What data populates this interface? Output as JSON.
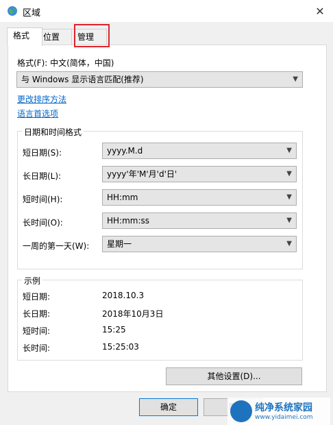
{
  "window": {
    "title": "区域",
    "close_glyph": "✕"
  },
  "tabs": [
    {
      "label": "格式"
    },
    {
      "label": "位置"
    },
    {
      "label": "管理"
    }
  ],
  "format": {
    "label": "格式(F): 中文(简体，中国)",
    "combo_value": "与 Windows 显示语言匹配(推荐)"
  },
  "links": {
    "change_sort": "更改排序方法",
    "lang_prefs": "语言首选项"
  },
  "datetime": {
    "group_title": "日期和时间格式",
    "rows": [
      {
        "label": "短日期(S):",
        "value": "yyyy.M.d"
      },
      {
        "label": "长日期(L):",
        "value": "yyyy'年'M'月'd'日'"
      },
      {
        "label": "短时间(H):",
        "value": "HH:mm"
      },
      {
        "label": "长时间(O):",
        "value": "HH:mm:ss"
      },
      {
        "label": "一周的第一天(W):",
        "value": "星期一"
      }
    ]
  },
  "example": {
    "group_title": "示例",
    "rows": [
      {
        "label": "短日期:",
        "value": "2018.10.3"
      },
      {
        "label": "长日期:",
        "value": "2018年10月3日"
      },
      {
        "label": "短时间:",
        "value": "15:25"
      },
      {
        "label": "长时间:",
        "value": "15:25:03"
      }
    ]
  },
  "buttons": {
    "other_settings": "其他设置(D)...",
    "ok": "确定",
    "cancel": "取"
  },
  "watermark": {
    "title": "纯净系统家园",
    "url": "www.yidaimei.com"
  },
  "colors": {
    "highlight": "#e0222a",
    "link": "#0066cc",
    "accent": "#0078d7"
  },
  "icons": {
    "window": "globe-icon",
    "dropdown": "chevron-down-icon"
  }
}
